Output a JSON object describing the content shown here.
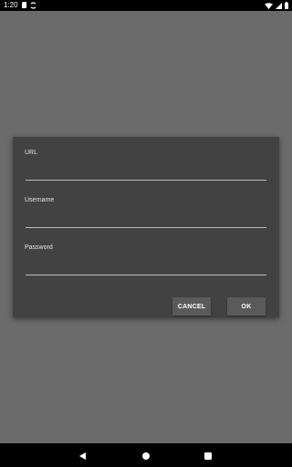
{
  "status_bar": {
    "time": "1:20",
    "left_icons": [
      "sd-card-icon",
      "sync-icon"
    ],
    "right_icons": [
      "wifi-icon",
      "signal-icon",
      "battery-icon"
    ]
  },
  "dialog": {
    "fields": [
      {
        "label": "URL",
        "value": "",
        "placeholder": ""
      },
      {
        "label": "Username",
        "value": "",
        "placeholder": ""
      },
      {
        "label": "Password",
        "value": "",
        "placeholder": ""
      }
    ],
    "buttons": {
      "cancel": "CANCEL",
      "ok": "OK"
    }
  },
  "nav_bar": {
    "icons": [
      "back-icon",
      "home-icon",
      "recents-icon"
    ]
  },
  "colors": {
    "scrim": "#6b6b6b",
    "dialog_bg": "#424242",
    "button_bg": "#5a5a5a"
  }
}
